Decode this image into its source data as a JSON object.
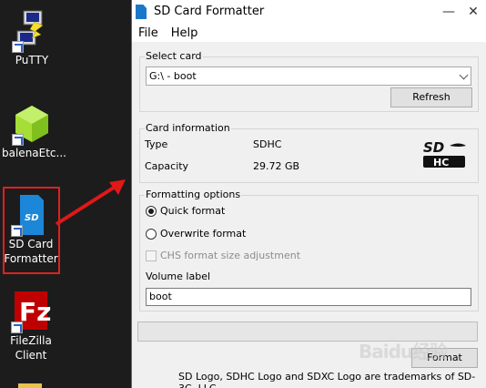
{
  "desktop": {
    "icons": [
      {
        "label": "PuTTY"
      },
      {
        "label": "balenaEtc..."
      },
      {
        "label_line1": "SD Card",
        "label_line2": "Formatter"
      },
      {
        "label_line1": "FileZilla",
        "label_line2": "Client"
      }
    ]
  },
  "window": {
    "title": "SD Card Formatter",
    "menu": [
      "File",
      "Help"
    ],
    "select_card": {
      "group_title": "Select card",
      "selected": "G:\\ - boot",
      "refresh_label": "Refresh"
    },
    "card_info": {
      "group_title": "Card information",
      "type_label": "Type",
      "type_value": "SDHC",
      "capacity_label": "Capacity",
      "capacity_value": "29.72 GB",
      "logo_text": "SD HC"
    },
    "formatting": {
      "group_title": "Formatting options",
      "quick_format": "Quick format",
      "overwrite_format": "Overwrite format",
      "chs_label": "CHS format size adjustment",
      "volume_label_caption": "Volume label",
      "volume_label_value": "boot"
    },
    "format_button": "Format",
    "footer": "SD Logo, SDHC Logo and SDXC Logo are trademarks of SD-3C, LLC."
  },
  "watermark": "Baidu经验"
}
